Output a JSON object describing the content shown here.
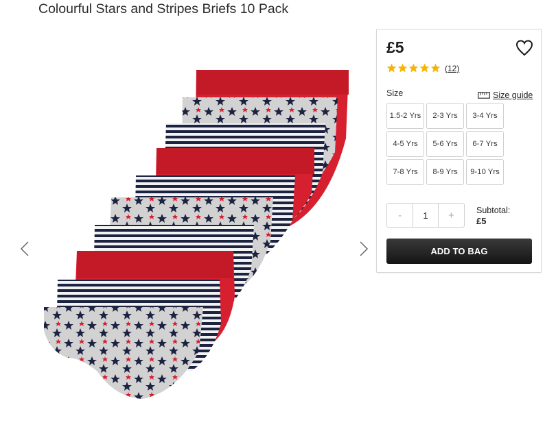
{
  "product": {
    "title": "Colourful Stars and Stripes Briefs 10 Pack",
    "image_icon": "product-photo-briefs",
    "price": "£5",
    "rating": 5,
    "rating_max": 5,
    "review_count": "(12)"
  },
  "gallery": {
    "prev_icon": "chevron-left-icon",
    "next_icon": "chevron-right-icon"
  },
  "size": {
    "label": "Size",
    "guide_label": "Size guide",
    "guide_icon": "ruler-icon",
    "options": [
      "1.5-2 Yrs",
      "2-3 Yrs",
      "3-4 Yrs",
      "4-5 Yrs",
      "5-6 Yrs",
      "6-7 Yrs",
      "7-8 Yrs",
      "8-9 Yrs",
      "9-10 Yrs"
    ]
  },
  "quantity": {
    "minus": "-",
    "value": "1",
    "plus": "+"
  },
  "subtotal": {
    "label": "Subtotal:",
    "amount": "£5"
  },
  "actions": {
    "add_to_bag": "ADD TO BAG",
    "wishlist_icon": "heart-icon"
  },
  "colors": {
    "star": "#f5b400",
    "brief_red": "#d6202f",
    "brief_navy": "#1c2340",
    "brief_grey": "#d2d2d2",
    "button_dark": "#1f1f1f"
  }
}
